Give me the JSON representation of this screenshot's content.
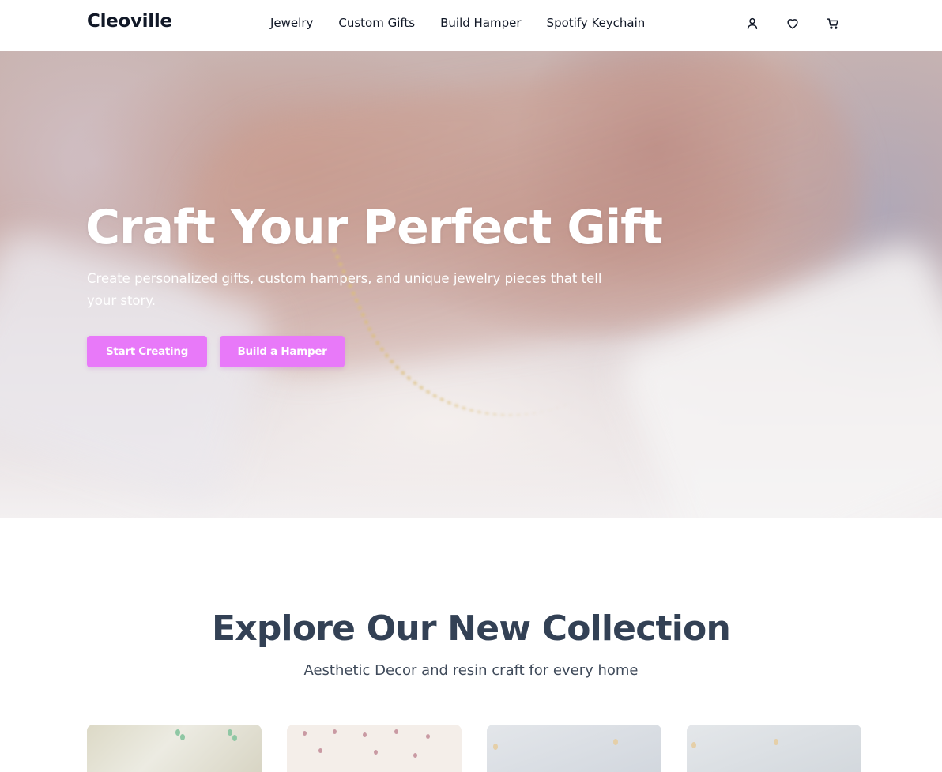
{
  "header": {
    "brand": "Cleoville",
    "nav": [
      "Jewelry",
      "Custom Gifts",
      "Build Hamper",
      "Spotify Keychain"
    ],
    "icons": [
      "user-icon",
      "heart-icon",
      "cart-icon"
    ]
  },
  "hero": {
    "title": "Craft Your Perfect Gift",
    "subtitle": "Create personalized gifts, custom hampers, and unique jewelry pieces that tell your story.",
    "buttons": {
      "start": "Start Creating",
      "hamper": "Build a Hamper"
    },
    "accent_color": "#e879f9"
  },
  "collection": {
    "title": "Explore Our New Collection",
    "subtitle": "Aesthetic Decor and resin craft for every home",
    "cards": 4
  }
}
